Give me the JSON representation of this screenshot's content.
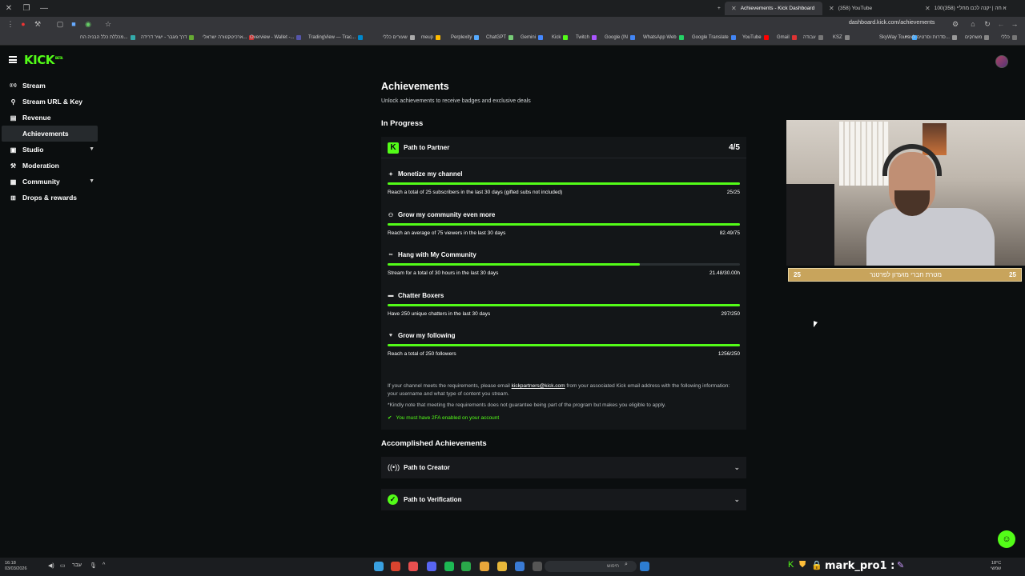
{
  "browser": {
    "tabs": [
      {
        "label": "Achievements - Kick Dashboard",
        "active": true,
        "color": "#53fc18"
      },
      {
        "label": "(358) YouTube",
        "active": false,
        "color": "#ff0000"
      },
      {
        "label": "100א חה | יקנה לכם מחליי (358)",
        "active": false,
        "color": "#ff0000"
      }
    ],
    "url": "dashboard.kick.com/achievements",
    "bookmarks": [
      "מכללת כלל הבניה הח...",
      "דרך מגבר - ישיר דרידה",
      "ארכיטקטורה ישראלי...",
      "Overview - Wallet -...",
      "TradingView — Trac...",
      "שעורים כללי",
      "meup",
      "Perplexity",
      "ChatGPT",
      "Gemini",
      "Kick",
      "Twitch",
      "Google (IN",
      "WhatsApp Web",
      "Google Translate",
      "YouTube",
      "Gmail",
      "עבודה",
      "KSZ",
      "SkyWay Tours",
      "סדרות וסרטים לצפיי...",
      "משחקים",
      "כללי"
    ]
  },
  "header": {
    "logo": "KICK",
    "logo_sup": "BETA"
  },
  "sidebar": {
    "items": [
      {
        "label": "Stream",
        "icon": "broadcast-icon",
        "glyph": "((•))",
        "active": false,
        "expandable": false
      },
      {
        "label": "Stream URL & Key",
        "icon": "link-icon",
        "glyph": "⚲",
        "active": false,
        "expandable": false
      },
      {
        "label": "Revenue",
        "icon": "revenue-icon",
        "glyph": "▤",
        "active": false,
        "expandable": false
      },
      {
        "label": "Achievements",
        "icon": "trophy-icon",
        "glyph": "",
        "active": true,
        "expandable": false
      },
      {
        "label": "Studio",
        "icon": "studio-icon",
        "glyph": "▣",
        "active": false,
        "expandable": true
      },
      {
        "label": "Moderation",
        "icon": "hammer-icon",
        "glyph": "⚒",
        "active": false,
        "expandable": false
      },
      {
        "label": "Community",
        "icon": "community-icon",
        "glyph": "▦",
        "active": false,
        "expandable": true
      },
      {
        "label": "Drops & rewards",
        "icon": "gift-icon",
        "glyph": "⊞",
        "active": false,
        "expandable": false
      }
    ]
  },
  "main": {
    "title": "Achievements",
    "subtitle": "Unlock achievements to receive badges and exclusive deals",
    "in_progress_title": "In Progress",
    "partner": {
      "title": "Path to Partner",
      "count": "4/5",
      "achievements": [
        {
          "title": "Monetize my channel",
          "icon": "sparkle-icon",
          "glyph": "✦",
          "desc": "Reach a total of 25 subscribers in the last 30 days (gifted subs not included)",
          "value": "25/25",
          "progress": 1.0
        },
        {
          "title": "Grow my community even more",
          "icon": "people-icon",
          "glyph": "⚇",
          "desc": "Reach an average of 75 viewers in the last 30 days",
          "value": "82.49/75",
          "progress": 1.0
        },
        {
          "title": "Hang with My Community",
          "icon": "infinity-icon",
          "glyph": "∞",
          "desc": "Stream for a total of 30 hours in the last 30 days",
          "value": "21.48/30.00h",
          "progress": 0.716
        },
        {
          "title": "Chatter Boxers",
          "icon": "chat-icon",
          "glyph": "▬",
          "desc": "Have 250 unique chatters in the last 30 days",
          "value": "297/250",
          "progress": 1.0
        },
        {
          "title": "Grow my following",
          "icon": "heart-icon",
          "glyph": "♥",
          "desc": "Reach a total of 250 followers",
          "value": "1256/250",
          "progress": 1.0
        }
      ],
      "note_prefix": "If your channel meets the requirements, please email ",
      "note_email": "kickpartners@kick.com",
      "note_suffix": " from your associated Kick email address with the following information: your username and what type of content you stream.",
      "note_disclaimer": "*Kindly note that meeting the requirements does not guarantee being part of the program but makes you eligible to apply.",
      "twofa": "You must have 2FA enabled on your account"
    },
    "accomplished_title": "Accomplished Achievements",
    "accomplished": [
      {
        "title": "Path to Creator",
        "icon": "broadcast-icon"
      },
      {
        "title": "Path to Verification",
        "icon": "verified-icon"
      }
    ]
  },
  "overlay": {
    "goal_left": "25",
    "goal_text": "מטרת חברי מועדון לפרטנר",
    "goal_right": "25"
  },
  "taskbar": {
    "time": "16:18",
    "date": "03/03/2026",
    "lang": "עבר",
    "search_placeholder": "חיפוש",
    "username": "mark_pro1 :",
    "weather": "18°C",
    "weather_desc": "שמשי"
  },
  "colors": {
    "accent": "#53fc18",
    "background": "#0b0e0f",
    "card": "#131618"
  }
}
